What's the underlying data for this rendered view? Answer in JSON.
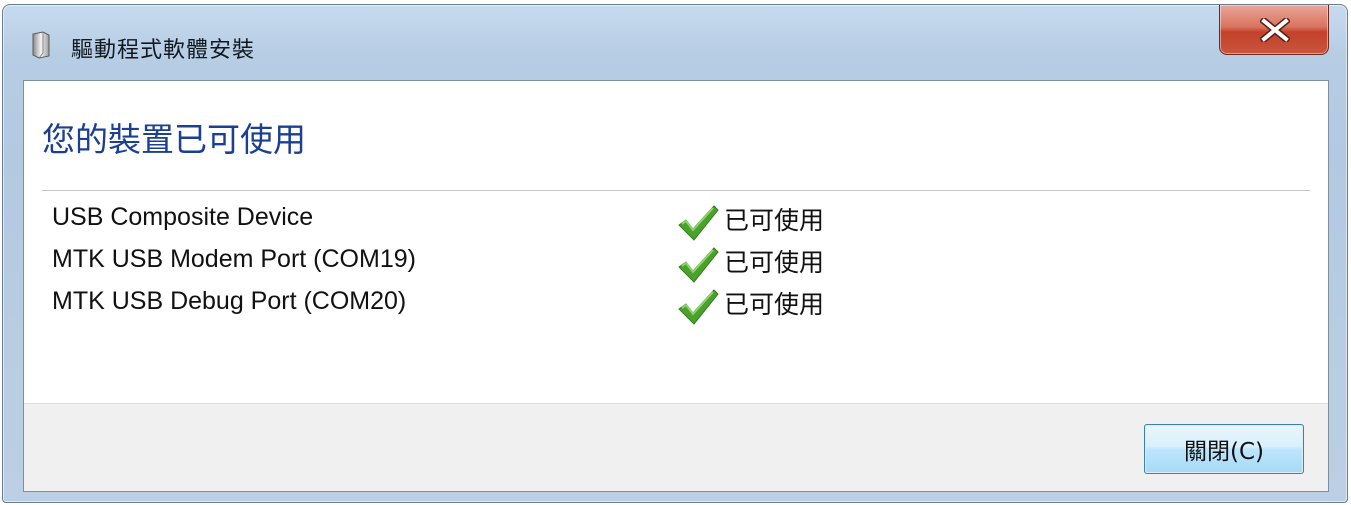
{
  "window": {
    "title": "驅動程式軟體安裝",
    "close_glyph": "X"
  },
  "main": {
    "heading": "您的裝置已可使用",
    "devices": [
      {
        "name": "USB Composite Device",
        "status": "已可使用"
      },
      {
        "name": "MTK USB Modem Port (COM19)",
        "status": "已可使用"
      },
      {
        "name": "MTK USB Debug Port (COM20)",
        "status": "已可使用"
      }
    ]
  },
  "footer": {
    "close_button_label": "關閉(C)"
  },
  "colors": {
    "heading": "#1b3f91",
    "check": "#4aa12b",
    "close_red": "#c4412b"
  },
  "icons": {
    "title": "device-driver-icon",
    "status": "checkmark-icon",
    "close": "close-icon"
  }
}
